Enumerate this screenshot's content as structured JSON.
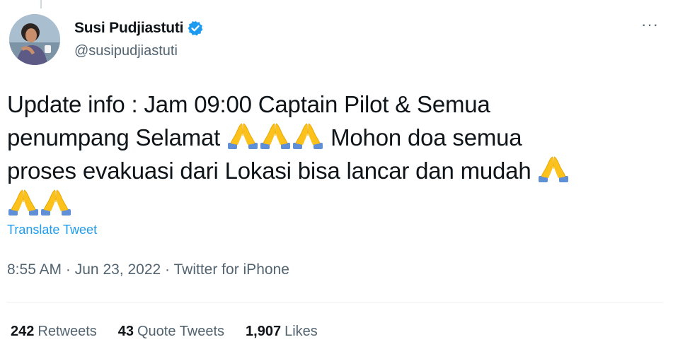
{
  "tweet": {
    "author": {
      "display_name": "Susi Pudjiastuti",
      "handle": "@susipudjiastuti",
      "verified": true,
      "avatar": "profile-photo"
    },
    "more_label": "···",
    "text_lines": [
      "Update info : Jam 09:00 Captain Pilot & Semua",
      "penumpang Selamat",
      "Mohon doa semua",
      "proses evakuasi dari Lokasi bisa lancar dan mudah"
    ],
    "emoji": "folded-hands",
    "translate_label": "Translate Tweet",
    "time": "8:55 AM",
    "date": "Jun 23, 2022",
    "source": "Twitter for iPhone",
    "separator": "·",
    "stats": {
      "retweets_count": "242",
      "retweets_label": "Retweets",
      "quotes_count": "43",
      "quotes_label": "Quote Tweets",
      "likes_count": "1,907",
      "likes_label": "Likes"
    }
  },
  "colors": {
    "accent": "#1d9bf0",
    "text": "#0f1419",
    "secondary": "#536471"
  }
}
